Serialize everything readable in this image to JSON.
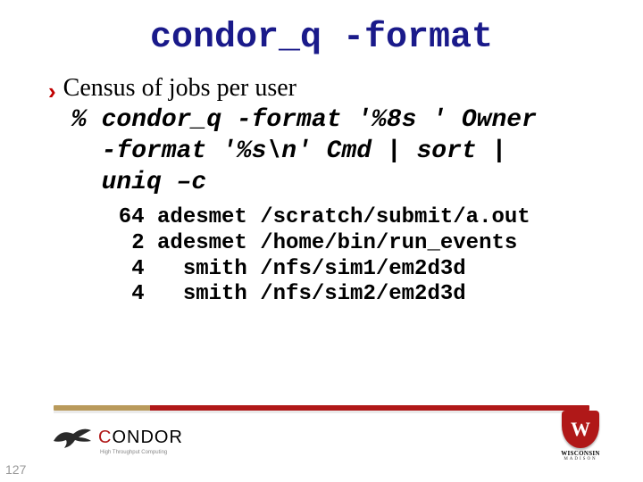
{
  "title": "condor_q -format",
  "bullet": "Census of jobs per user",
  "command": "% condor_q -format '%8s ' Owner\n  -format '%s\\n' Cmd | sort |\n  uniq –c",
  "output_rows": [
    {
      "count": 64,
      "owner": "adesmet",
      "cmd": "/scratch/submit/a.out"
    },
    {
      "count": 2,
      "owner": "adesmet",
      "cmd": "/home/bin/run_events"
    },
    {
      "count": 4,
      "owner": "smith",
      "cmd": "/nfs/sim1/em2d3d"
    },
    {
      "count": 4,
      "owner": "smith",
      "cmd": "/nfs/sim2/em2d3d"
    }
  ],
  "logos": {
    "condor_letter": "C",
    "condor_rest": "ONDOR",
    "condor_sub": "High Throughput Computing",
    "wisc_letter": "W",
    "wisc_line1": "WISCONSIN",
    "wisc_line2": "MADISON"
  },
  "page_number": "127"
}
